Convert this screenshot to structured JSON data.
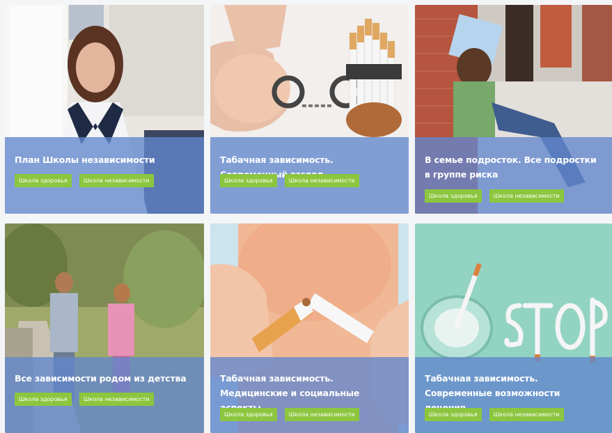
{
  "cards": [
    {
      "title": "План Школы независимости",
      "tags": [
        "Школа здоровья",
        "Школа независимости"
      ]
    },
    {
      "title": "Табачная зависимость. Современный взгляд.",
      "tags": [
        "Школа здоровья",
        "Школа независимости"
      ]
    },
    {
      "title": "В семье подросток. Все подростки в группе риска",
      "tags": [
        "Школа здоровья",
        "Школа независимости"
      ]
    },
    {
      "title": "Все зависимости родом из детства",
      "tags": [
        "Школа здоровья",
        "Школа независимости"
      ]
    },
    {
      "title": "Табачная зависимость. Медицинские и социальные аспекты",
      "tags": [
        "Школа здоровья",
        "Школа независимости"
      ]
    },
    {
      "title": "Табачная зависимость. Современные возможности лечения",
      "tags": [
        "Школа здоровья",
        "Школа независимости"
      ]
    }
  ],
  "colors": {
    "overlay": "#6286cd",
    "tag": "#8cc63f"
  },
  "image_subjects": [
    "doctor-portrait",
    "handcuffed-cigarettes",
    "sad-teenager",
    "children-walking",
    "broken-cigarette",
    "stop-cigarettes"
  ]
}
